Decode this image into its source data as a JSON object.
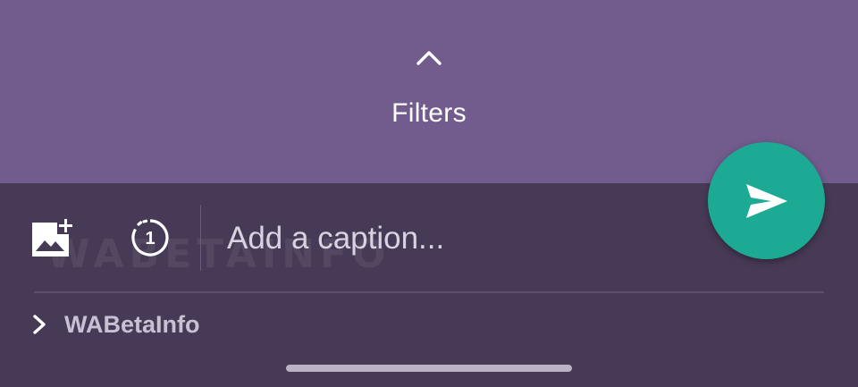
{
  "filters": {
    "label": "Filters",
    "toggle_icon": "chevron-up-icon"
  },
  "composer": {
    "add_media_icon": "add-photo-icon",
    "view_once_icon": "view-once-icon",
    "view_once_number": "1",
    "caption_placeholder": "Add a caption...",
    "caption_value": "",
    "watermark_text": "WABETAINFO"
  },
  "send": {
    "icon": "send-icon",
    "color": "#1daa94"
  },
  "recipient": {
    "icon": "chevron-right-icon",
    "label": "WABetaInfo"
  },
  "colors": {
    "filter_panel": "#725b8d",
    "bottom_panel": "#473a57",
    "accent": "#1daa94"
  }
}
